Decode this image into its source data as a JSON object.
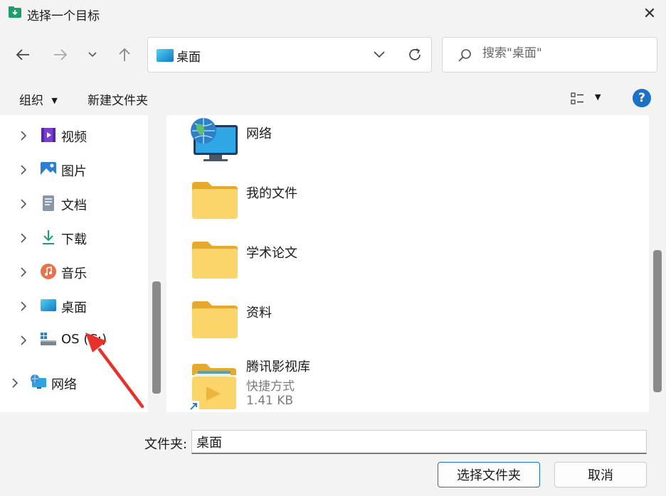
{
  "window": {
    "title": "选择一个目标",
    "close_glyph": "✕"
  },
  "address": {
    "path": "桌面",
    "search_placeholder": "搜索\"桌面\""
  },
  "toolbar": {
    "organize_label": "组织",
    "new_folder_label": "新建文件夹"
  },
  "sidebar": {
    "items": [
      {
        "label": "视频",
        "icon": "videos-icon"
      },
      {
        "label": "图片",
        "icon": "pictures-icon"
      },
      {
        "label": "文档",
        "icon": "documents-icon"
      },
      {
        "label": "下载",
        "icon": "downloads-icon"
      },
      {
        "label": "音乐",
        "icon": "music-icon"
      },
      {
        "label": "桌面",
        "icon": "desktop-icon"
      },
      {
        "label": "OS (C:)",
        "icon": "drive-icon"
      },
      {
        "label": "网络",
        "icon": "network-icon"
      }
    ]
  },
  "files": [
    {
      "name": "网络",
      "icon": "network-icon"
    },
    {
      "name": "我的文件",
      "icon": "folder-icon"
    },
    {
      "name": "学术论文",
      "icon": "folder-icon"
    },
    {
      "name": "资料",
      "icon": "folder-icon"
    },
    {
      "name": "腾讯影视库",
      "type": "快捷方式",
      "size": "1.41 KB",
      "icon": "shortcut-icon"
    }
  ],
  "footer": {
    "folder_label": "文件夹:",
    "folder_value": "桌面",
    "select_button": "选择文件夹",
    "cancel_button": "取消"
  },
  "colors": {
    "accent": "#1a73c8",
    "folder": "#f7c948",
    "annotation_arrow": "#e8312a"
  }
}
